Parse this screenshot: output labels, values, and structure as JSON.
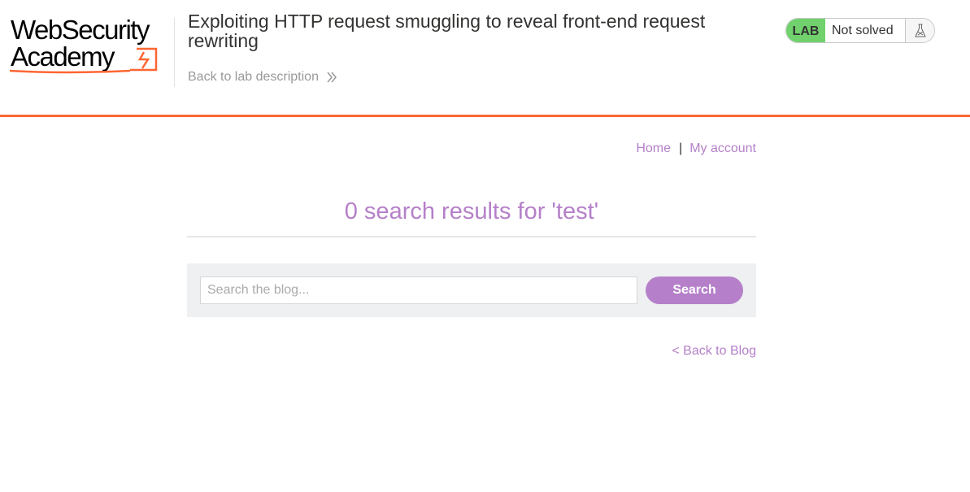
{
  "header": {
    "logo": {
      "line1": "WebSecurity",
      "line2": "Academy",
      "accent_color": "#ff6633"
    },
    "lab_title": "Exploiting HTTP request smuggling to reveal front-end request rewriting",
    "back_link_label": "Back to lab description",
    "back_link_icon": "double-chevron-right-icon",
    "status": {
      "badge": "LAB",
      "badge_color": "#70d16d",
      "text": "Not solved",
      "icon": "flask-icon"
    }
  },
  "accent_bar_color": "#ff6633",
  "nav": {
    "home_label": "Home",
    "separator": "|",
    "account_label": "My account"
  },
  "search_results": {
    "heading": "0 search results for 'test'",
    "heading_color": "#b580c9"
  },
  "search": {
    "placeholder": "Search the blog...",
    "value": "",
    "button_label": "Search",
    "button_color": "#b580c9"
  },
  "back_to_blog_label": "< Back to Blog"
}
